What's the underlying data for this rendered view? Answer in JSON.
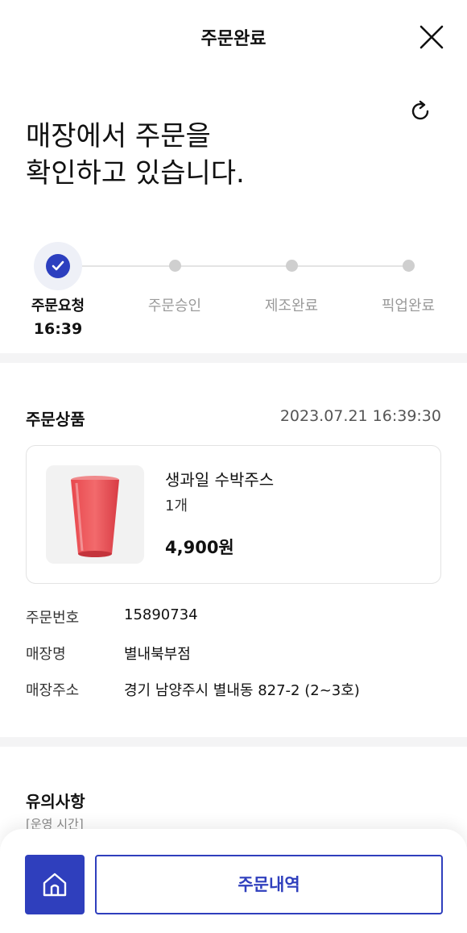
{
  "header": {
    "title": "주문완료",
    "close_icon": "close-icon",
    "refresh_icon": "refresh-icon"
  },
  "headline": {
    "line1": "매장에서 주문을",
    "line2": "확인하고 있습니다."
  },
  "progress": {
    "steps": [
      {
        "label": "주문요청",
        "time": "16:39",
        "state": "done"
      },
      {
        "label": "주문승인",
        "state": "pending"
      },
      {
        "label": "제조완료",
        "state": "pending"
      },
      {
        "label": "픽업완료",
        "state": "pending"
      }
    ]
  },
  "order": {
    "section_title": "주문상품",
    "datetime": "2023.07.21 16:39:30",
    "product": {
      "name": "생과일 수박주스",
      "quantity": "1개",
      "price": "4,900원"
    },
    "info": [
      {
        "key": "주문번호",
        "value": "15890734"
      },
      {
        "key": "매장명",
        "value": "별내북부점"
      },
      {
        "key": "매장주소",
        "value": "경기 남양주시 별내동 827-2 (2~3호)"
      }
    ]
  },
  "notice": {
    "title": "유의사항",
    "subtitle": "[운영 시간]"
  },
  "bottom": {
    "home_icon": "home-icon",
    "history_label": "주문내역"
  },
  "colors": {
    "accent": "#2f3fbd",
    "divider": "#f4f4f5",
    "muted_text": "#9a9a9a"
  }
}
